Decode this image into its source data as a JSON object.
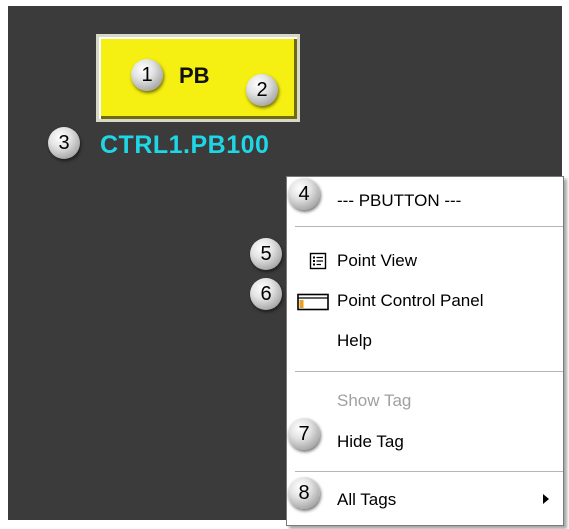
{
  "button": {
    "label": "PB"
  },
  "tag": {
    "text": "CTRL1.PB100"
  },
  "callouts": [
    "1",
    "2",
    "3",
    "4",
    "5",
    "6",
    "7",
    "8"
  ],
  "menu": {
    "header": "--- PBUTTON ---",
    "point_view": "Point View",
    "point_control_panel": "Point Control Panel",
    "help": "Help",
    "show_tag": "Show Tag",
    "hide_tag": "Hide Tag",
    "all_tags": "All Tags"
  },
  "colors": {
    "background": "#3b3b3b",
    "button_fill": "#f5f011",
    "tag_text": "#1fd6e6",
    "disabled_text": "#a0a0a0"
  },
  "icons": {
    "point_view": "point-view-icon",
    "point_control_panel": "point-control-panel-icon",
    "submenu": "submenu-arrow-icon"
  }
}
